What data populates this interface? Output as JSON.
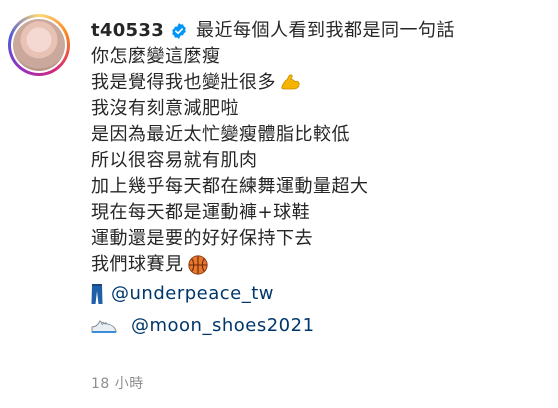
{
  "post": {
    "username": "t40533",
    "caption_lines": [
      "最近每個人看到我都是同一句話",
      "你怎麼變這麼瘦",
      "我是覺得我也變壯很多",
      "我沒有刻意減肥啦",
      "是因為最近太忙變瘦體脂比較低",
      "所以很容易就有肌肉",
      "加上幾乎每天都在練舞運動量超大",
      "現在每天都是運動褲+球鞋",
      "運動還是要的好好保持下去",
      "我們球賽見"
    ],
    "mentions": [
      "@underpeace_tw",
      "@moon_shoes2021"
    ],
    "timestamp": "18 小時"
  },
  "icons": {
    "verified": "verified-badge-icon",
    "muscle": "flexed-biceps-icon",
    "basketball": "basketball-icon",
    "pants": "jeans-icon",
    "shoe": "running-shoe-icon"
  },
  "colors": {
    "text": "#262626",
    "mention": "#00376b",
    "verified": "#0095f6",
    "timestamp": "#8e8e8e"
  }
}
